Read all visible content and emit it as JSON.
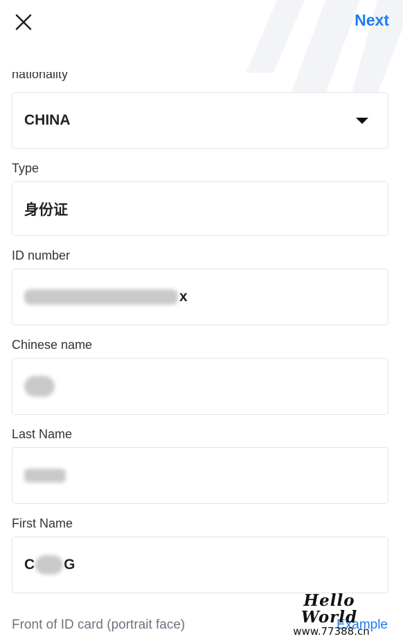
{
  "header": {
    "close_icon": "close-icon",
    "next_label": "Next"
  },
  "form": {
    "nationality": {
      "label": "nationality",
      "value": "CHINA",
      "icon": "caret-down-icon"
    },
    "type": {
      "label": "Type",
      "value": "身份证"
    },
    "id_number": {
      "label": "ID number",
      "value_visible_end": "x"
    },
    "chinese_name": {
      "label": "Chinese name"
    },
    "last_name": {
      "label": "Last Name"
    },
    "first_name": {
      "label": "First Name",
      "value_visible_start": "C",
      "value_visible_end": "G"
    }
  },
  "id_card": {
    "front_label": "Front of ID card (portrait face)",
    "example_label": "Example"
  },
  "watermark": {
    "line1": "Hello World",
    "line2": "www.77388.cn"
  },
  "colors": {
    "accent": "#1f7bf2",
    "border": "#e3e3e3",
    "muted_text": "#6b7280"
  }
}
